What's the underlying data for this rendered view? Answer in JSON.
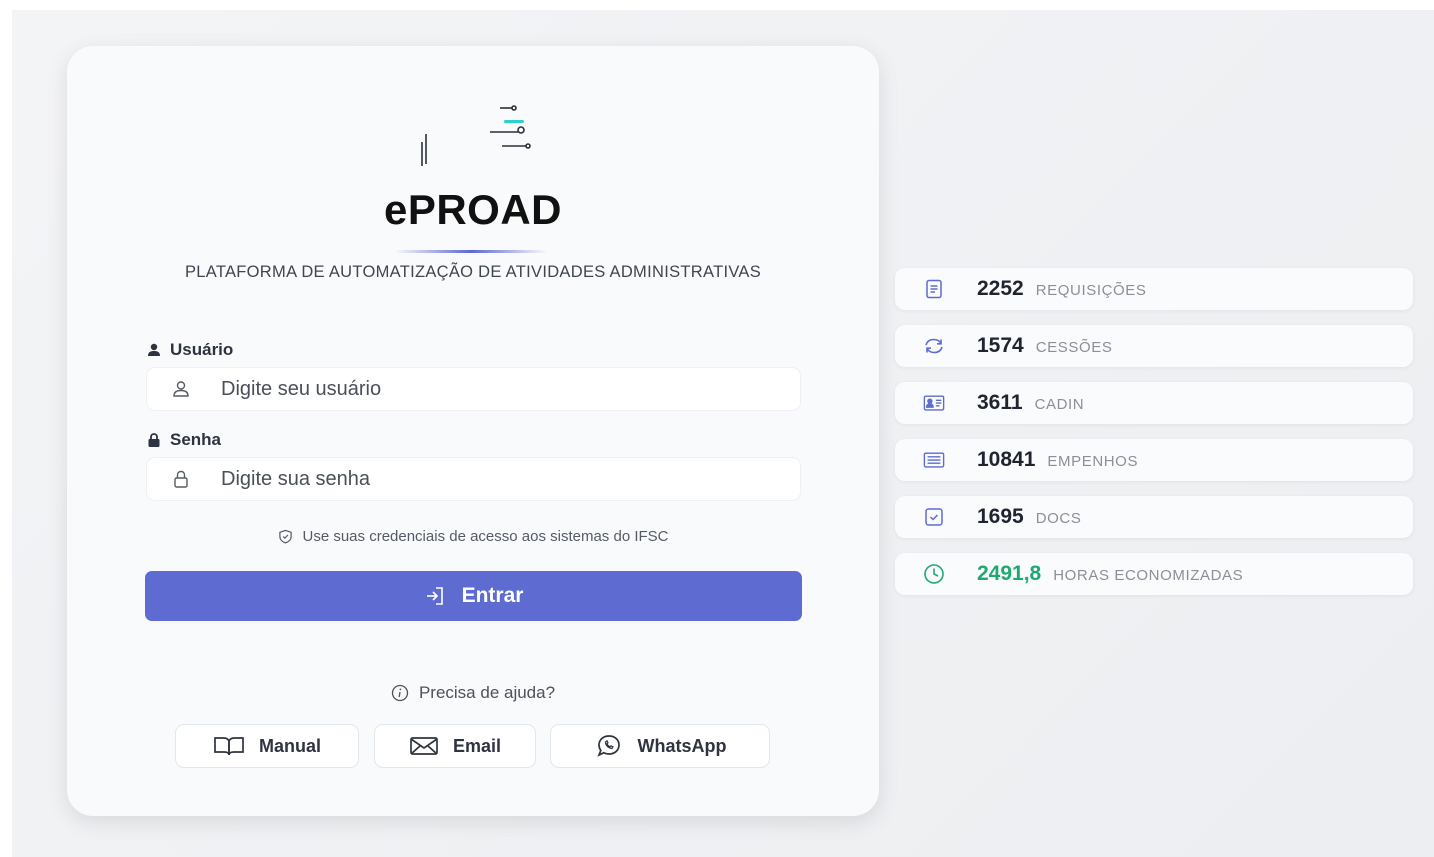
{
  "app": {
    "title": "ePROAD",
    "subtitle": "PLATAFORMA DE AUTOMATIZAÇÃO DE ATIVIDADES ADMINISTRATIVAS",
    "logo_icon": "eproad-logo"
  },
  "form": {
    "username_label": "Usuário",
    "username_placeholder": "Digite seu usuário",
    "username_value": "",
    "password_label": "Senha",
    "password_placeholder": "Digite sua senha",
    "password_value": "",
    "hint": "Use suas credenciais de acesso aos sistemas do IFSC",
    "submit_label": "Entrar"
  },
  "help": {
    "prompt": "Precisa de ajuda?",
    "buttons": [
      {
        "label": "Manual",
        "icon": "book-icon"
      },
      {
        "label": "Email",
        "icon": "envelope-icon"
      },
      {
        "label": "WhatsApp",
        "icon": "whatsapp-icon"
      }
    ]
  },
  "stats": [
    {
      "value": "2252",
      "label": "REQUISIÇÕES",
      "icon": "document-icon"
    },
    {
      "value": "1574",
      "label": "CESSÕES",
      "icon": "refresh-icon"
    },
    {
      "value": "3611",
      "label": "CADIN",
      "icon": "id-card-icon"
    },
    {
      "value": "10841",
      "label": "EMPENHOS",
      "icon": "list-icon"
    },
    {
      "value": "1695",
      "label": "DOCS",
      "icon": "file-check-icon"
    },
    {
      "value": "2491,8",
      "label": "HORAS ECONOMIZADAS",
      "icon": "clock-icon",
      "accent": "#1fa971"
    }
  ],
  "colors": {
    "primary": "#5e6bd0",
    "accent_green": "#1fa971",
    "card_bg": "#f9fafb",
    "page_bg": "#eceef1"
  }
}
